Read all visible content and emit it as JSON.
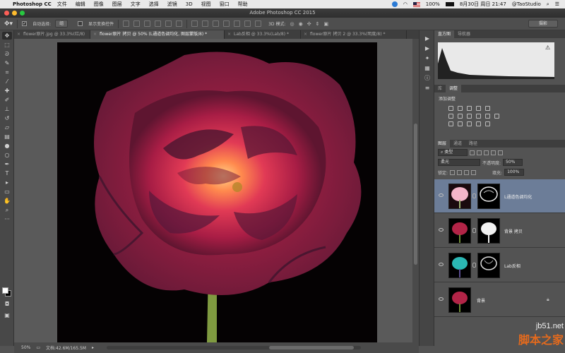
{
  "menubar": {
    "app_name": "Photoshop CC",
    "items": [
      "文件",
      "编辑",
      "图像",
      "图层",
      "文字",
      "选择",
      "滤镜",
      "3D",
      "视图",
      "窗口",
      "帮助"
    ],
    "battery": "100%",
    "datetime": "8月30日 周日 21:47",
    "user": "@TaoStudio"
  },
  "window": {
    "title": "Adobe Photoshop CC 2015"
  },
  "options": {
    "auto_select_label": "自动选择:",
    "auto_select_value": "组",
    "show_transform_label": "显示变换控件",
    "mode_3d_label": "3D 模式:",
    "workspace": "摄影"
  },
  "tabs": [
    {
      "label": "flower原片.jpg @ 33.3%(红/8)",
      "active": false
    },
    {
      "label": "flower原片 拷贝 @ 50% (L通道色调均化, 图层蒙版/8) *",
      "active": true
    },
    {
      "label": "Lab反相 @ 33.3%(Lab/8) *",
      "active": false
    },
    {
      "label": "flower原片 拷贝 2 @ 33.3%(明度/8) *",
      "active": false
    }
  ],
  "status": {
    "zoom": "50%",
    "doc": "文档:42.6M/165.5M"
  },
  "panels": {
    "histogram_tabs": [
      "直方图",
      "导航器"
    ],
    "adjust_tabs": [
      "库",
      "调整"
    ],
    "adjust_title": "添加调整",
    "layers_tabs": [
      "图层",
      "通道",
      "路径"
    ],
    "kind_filter": "类型",
    "blend_mode": "柔光",
    "opacity_label": "不透明度:",
    "opacity_value": "50%",
    "lock_label": "锁定:",
    "fill_label": "填充:",
    "fill_value": "100%"
  },
  "layers": [
    {
      "name": "L通道色调均化",
      "selected": true,
      "locked": false
    },
    {
      "name": "背景 拷贝",
      "selected": false,
      "locked": false
    },
    {
      "name": "Lab反相",
      "selected": false,
      "locked": false
    },
    {
      "name": "背景",
      "selected": false,
      "locked": true
    }
  ],
  "watermark": {
    "line1": "jb51.net",
    "line2": "脚本之家"
  },
  "colors": {
    "accent_selected": "#6c7d98",
    "watermark_orange": "#e46a1d",
    "flower": "#c2234b"
  }
}
